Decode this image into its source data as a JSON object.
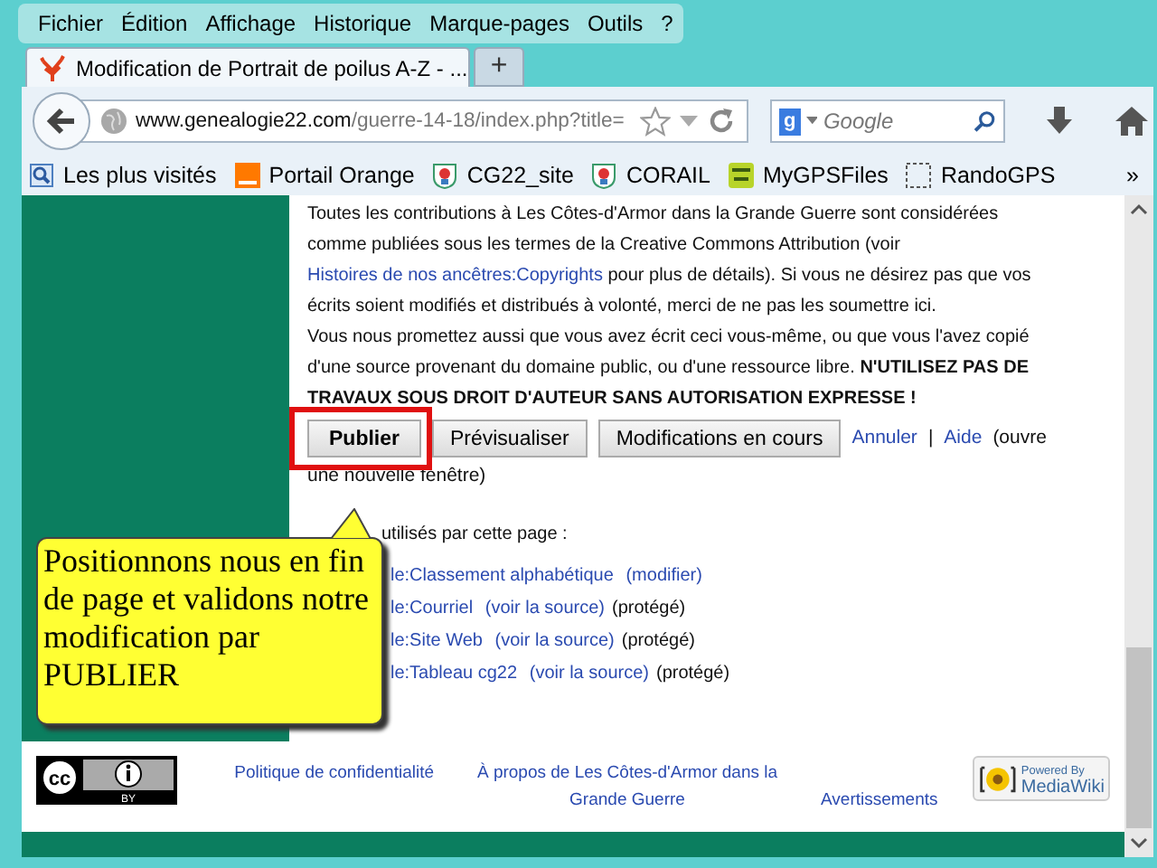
{
  "menu": [
    "Fichier",
    "Édition",
    "Affichage",
    "Historique",
    "Marque-pages",
    "Outils",
    "?"
  ],
  "tabs": [
    {
      "label": "Modification de Portrait de poilus A-Z - ...",
      "selected": true
    }
  ],
  "new_tab": "+",
  "address": {
    "host": "www.genealogie22.com",
    "path": "/guerre-14-18/index.php?title="
  },
  "search": {
    "engine_badge": "g",
    "placeholder": "Google"
  },
  "bookmarks": [
    {
      "label": "Les plus visités",
      "kind": "folder"
    },
    {
      "label": "Portail Orange",
      "kind": "orange"
    },
    {
      "label": "CG22_site",
      "kind": "crest"
    },
    {
      "label": "CORAIL",
      "kind": "crest"
    },
    {
      "label": "MyGPSFiles",
      "kind": "gps"
    },
    {
      "label": "RandoGPS",
      "kind": "blank"
    }
  ],
  "bookmarks_overflow": "»",
  "notice": [
    [
      {
        "kind": "text",
        "text": "Toutes les contributions à Les Côtes-d'Armor dans la Grande Guerre sont considérées comme publiées sous les termes de la Creative Commons Attribution (voir "
      },
      {
        "kind": "link",
        "text": "Histoires de"
      },
      {
        "kind": "link",
        "text": "nos ancêtres:Copyrights"
      },
      {
        "kind": "text",
        "text": " pour plus de détails). Si vous ne désirez pas que vos écrits soient modifiés et distribués à volonté, merci de ne pas les soumettre ici."
      }
    ],
    [
      {
        "kind": "text",
        "text": "Vous nous promettez aussi que vous avez écrit ceci vous-même, ou que vous l'avez copié d'une source provenant du domaine public, ou d'une ressource libre. "
      },
      {
        "kind": "bold",
        "text": "N'UTILISEZ PAS DE TRAVAUX SOUS DROIT D'AUTEUR SANS AUTORISATION EXPRESSE !"
      }
    ]
  ],
  "buttons": [
    {
      "label": "Publier",
      "primary": true,
      "highlighted": true
    },
    {
      "label": "Prévisualiser",
      "primary": false,
      "highlighted": false
    },
    {
      "label": "Modifications en cours",
      "primary": false,
      "highlighted": false
    }
  ],
  "edit_links": [
    {
      "kind": "link",
      "text": "Annuler"
    },
    {
      "kind": "text",
      "text": "|"
    },
    {
      "kind": "link",
      "text": "Aide"
    },
    {
      "kind": "text",
      "text": "(ouvre"
    },
    {
      "kind": "wrap_text",
      "text": "une nouvelle fenêtre)"
    }
  ],
  "templates_heading": "utilisés par cette page :",
  "templates": [
    {
      "name": "le:Classement alphabétique",
      "action": "(modifier)"
    },
    {
      "name": "le:Courriel",
      "action": "(voir la source)",
      "status": "(protégé)"
    },
    {
      "name": "le:Site Web",
      "action": "(voir la source)",
      "status": "(protégé)"
    },
    {
      "name": "le:Tableau cg22",
      "action": "(voir la source)",
      "status": "(protégé)"
    }
  ],
  "callout": "Positionnons nous en fin de page et validons notre modification par PUBLIER",
  "footer": {
    "license_badge": {
      "symbol": "cc",
      "label": "BY"
    },
    "links": [
      "Politique de confidentialité",
      "À propos de Les Côtes-d'Armor dans la Grande Guerre",
      "Avertissements"
    ],
    "powered_badge": {
      "line1": "Powered By",
      "line2": "MediaWiki"
    }
  }
}
